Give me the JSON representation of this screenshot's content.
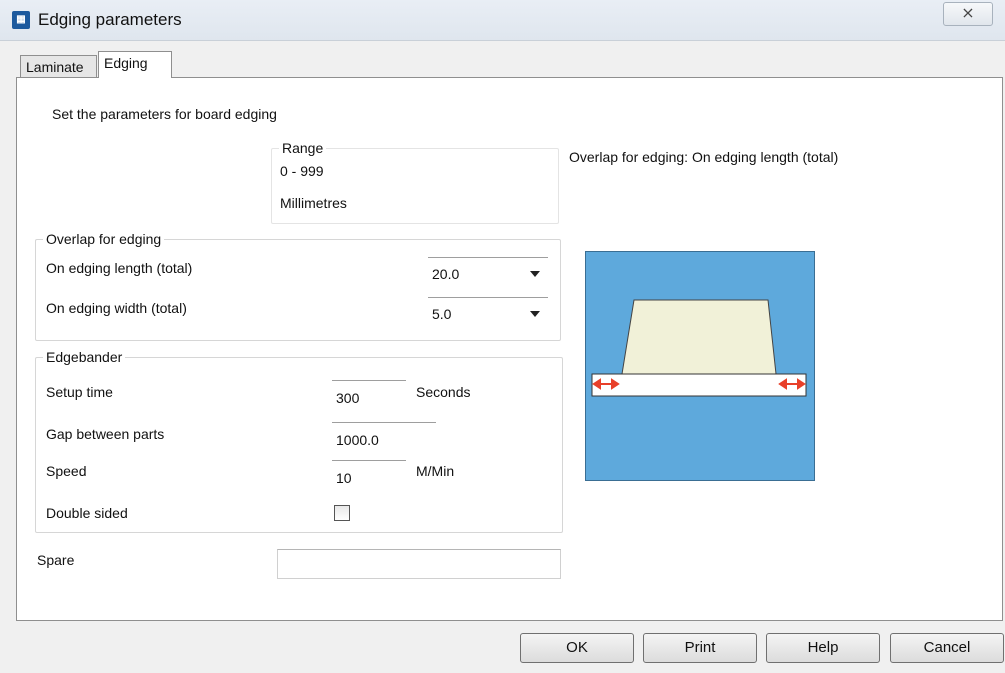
{
  "window": {
    "title": "Edging parameters",
    "close_glyph": "⨯"
  },
  "tabs": [
    {
      "label": "Laminate"
    },
    {
      "label": "Edging"
    }
  ],
  "intro_text": "Set the parameters for board edging",
  "range": {
    "legend": "Range",
    "value": "0 - 999",
    "unit": "Millimetres"
  },
  "overlap": {
    "legend": "Overlap for edging",
    "length_label": "On edging length (total)",
    "length_value": "20.0",
    "width_label": "On edging width (total)",
    "width_value": "5.0"
  },
  "edgebander": {
    "legend": "Edgebander",
    "setup_label": "Setup time",
    "setup_value": "300",
    "setup_unit": "Seconds",
    "gap_label": "Gap between parts",
    "gap_value": "1000.0",
    "speed_label": "Speed",
    "speed_value": "10",
    "speed_unit": "M/Min",
    "double_label": "Double sided",
    "double_checked": false
  },
  "spare": {
    "label": "Spare",
    "value": ""
  },
  "preview_caption": "Overlap for edging: On edging length (total)",
  "buttons": {
    "ok": "OK",
    "print": "Print",
    "help": "Help",
    "cancel": "Cancel"
  },
  "colors": {
    "preview_bg": "#5ea9dc",
    "board": "#f1f1d8",
    "arrow": "#e8402a"
  }
}
